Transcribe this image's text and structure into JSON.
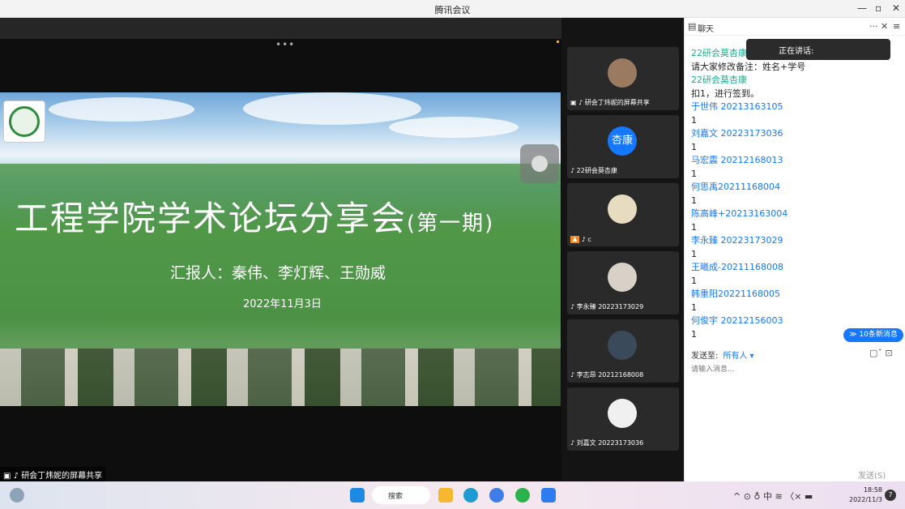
{
  "window": {
    "title": "腾讯会议",
    "controls": [
      "—",
      "▫",
      "✕"
    ]
  },
  "slide": {
    "title_main": "工程学院学术论坛分享会",
    "title_suffix": "(第一期)",
    "reporter": "汇报人：秦伟、李灯辉、王勋威",
    "date": "2022年11月3日"
  },
  "share_label": "研会丁炜妮的屏幕共享",
  "participants": [
    {
      "name": "研会丁炜妮的屏幕共享",
      "avatar": ""
    },
    {
      "name": "22研会莫杏康",
      "avatar": "杏康"
    },
    {
      "name": "c",
      "avatar": ""
    },
    {
      "name": "李永臻 20223173029",
      "avatar": ""
    },
    {
      "name": "李志昂 20212168008",
      "avatar": ""
    },
    {
      "name": "刘嘉文 20223173036",
      "avatar": ""
    }
  ],
  "chat": {
    "title": "聊天",
    "speaking_label": "正在讲话:",
    "messages": [
      {
        "type": "sender",
        "text": "22研会莫杏康"
      },
      {
        "type": "body",
        "text": "请大家修改备注：姓名+学号"
      },
      {
        "type": "sender",
        "text": "22研会莫杏康"
      },
      {
        "type": "body",
        "text": "扣1，进行签到。"
      },
      {
        "type": "name",
        "text": "于世伟 20213163105"
      },
      {
        "type": "body",
        "text": "1"
      },
      {
        "type": "name",
        "text": "刘嘉文 20223173036"
      },
      {
        "type": "body",
        "text": "1"
      },
      {
        "type": "name",
        "text": "马宏震 20212168013"
      },
      {
        "type": "body",
        "text": "1"
      },
      {
        "type": "name",
        "text": "何思禹20211168004"
      },
      {
        "type": "body",
        "text": "1"
      },
      {
        "type": "name",
        "text": "陈高峰+20213163004"
      },
      {
        "type": "body",
        "text": "1"
      },
      {
        "type": "name",
        "text": "李永臻 20223173029"
      },
      {
        "type": "body",
        "text": "1"
      },
      {
        "type": "name",
        "text": "王曦成-20211168008"
      },
      {
        "type": "body",
        "text": "1"
      },
      {
        "type": "name",
        "text": "韩重阳20221168005"
      },
      {
        "type": "body",
        "text": "1"
      },
      {
        "type": "name",
        "text": "何俊宇 20212156003"
      },
      {
        "type": "body",
        "text": "1"
      }
    ],
    "new_messages_badge": "≫ 10条新消息",
    "send_to_label": "发送至:",
    "send_to_value": "所有人 ▾",
    "input_placeholder": "请输入消息...",
    "send_button": "发送(S)"
  },
  "taskbar": {
    "search_label": "搜索",
    "tray_text": "^ ⊙ ♁ 中 ≋ 〈× ▬",
    "time": "18:58",
    "date": "2022/11/3",
    "notification_count": "7"
  },
  "colors": {
    "accent": "#1677ff",
    "sender_green": "#1aad8f",
    "slide_green": "#4e9648"
  }
}
